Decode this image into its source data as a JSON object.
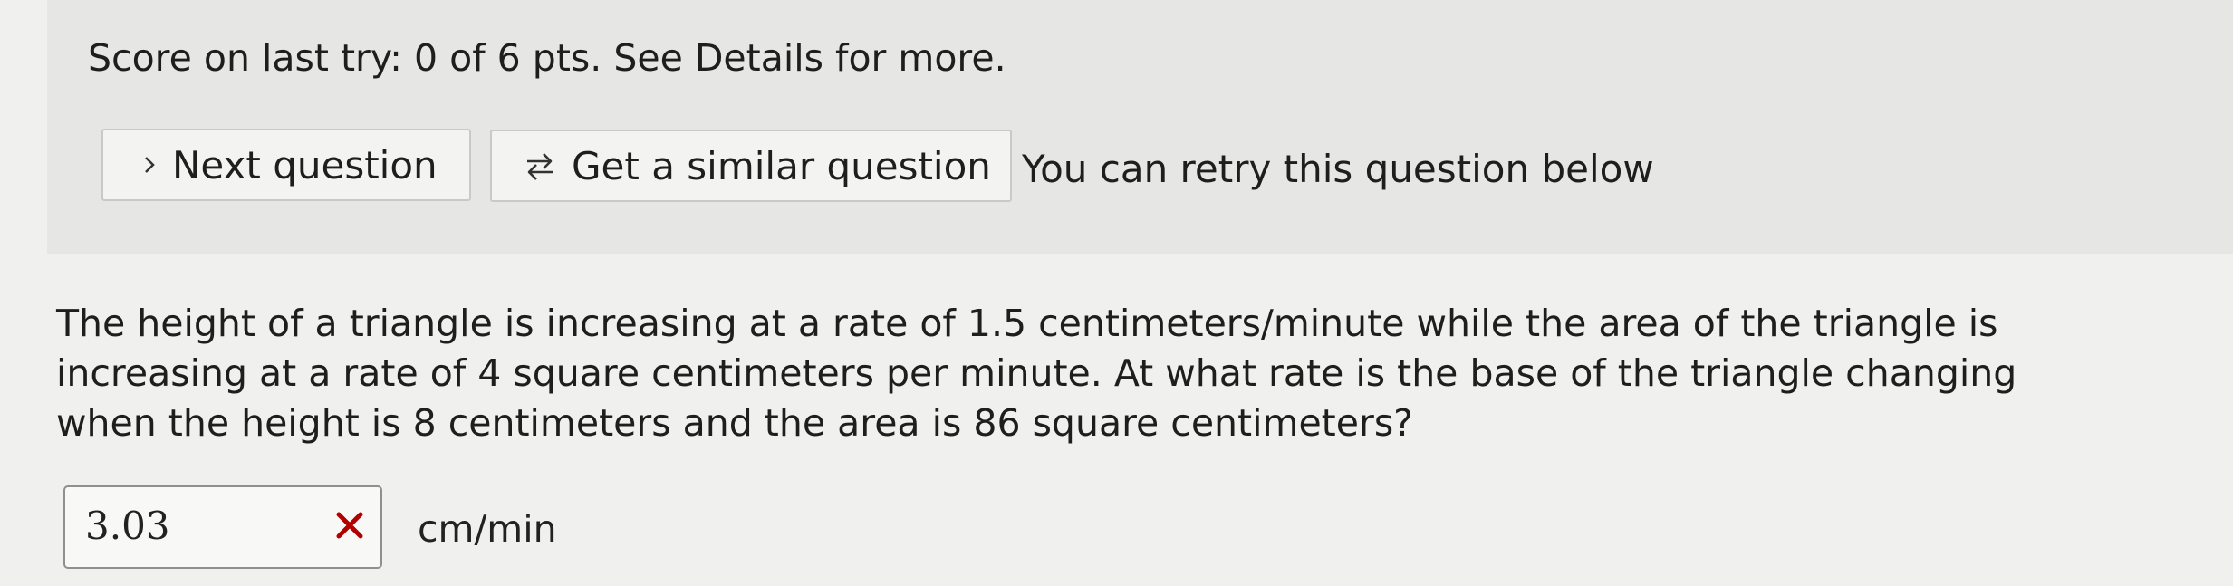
{
  "score": {
    "text": "Score on last try: 0 of 6 pts. See Details for more."
  },
  "actions": {
    "next_question_label": "Next question",
    "similar_question_label": "Get a similar question",
    "retry_message": "You can retry this question below"
  },
  "icons": {
    "next": "chevron-right-icon",
    "similar": "swap-arrows-icon",
    "result": "wrong-answer-x-icon"
  },
  "colors": {
    "wrong_mark": "#b00000"
  },
  "question": {
    "text": "The height of a triangle is increasing at a rate of 1.5 centimeters/minute while the area of the triangle is increasing at a rate of 4 square centimeters per minute. At what rate is the base of the triangle changing when the height is 8 centimeters and the area is 86 square centimeters?"
  },
  "answer": {
    "value": "3.03",
    "unit": "cm/min",
    "status": "incorrect"
  }
}
